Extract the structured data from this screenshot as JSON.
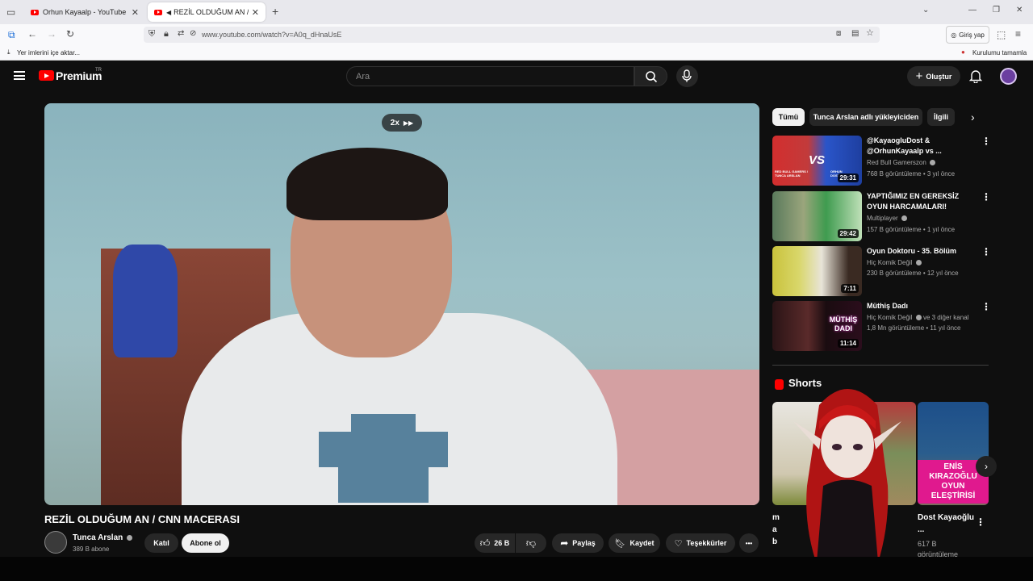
{
  "browser": {
    "tabs": [
      {
        "label": "Orhun Kayaalp - YouTube",
        "active": false
      },
      {
        "label": "REZİL OLDUĞUM AN / CNN",
        "active": true
      }
    ],
    "new_tab": "+",
    "url": "www.youtube.com/watch?v=A0q_dHnaUsE",
    "login_label": "Giriş yap",
    "bookmark_import": "Yer imlerini içe aktar...",
    "setup_notice": "Kurulumu tamamla"
  },
  "header": {
    "logo": "Premium",
    "logo_sup": "TR",
    "search_placeholder": "Ara",
    "create_label": "Oluştur",
    "create_plus": "+"
  },
  "player": {
    "speed": "2x"
  },
  "video": {
    "title": "REZİL OLDUĞUM AN / CNN MACERASI",
    "channel": "Tunca Arslan",
    "subscribers": "389 B abone",
    "join_label": "Katıl",
    "subscribe_label": "Abone ol",
    "likes": "26 B",
    "share_label": "Paylaş",
    "save_label": "Kaydet",
    "thanks_label": "Teşekkürler",
    "more": "•••"
  },
  "chips": [
    "Tümü",
    "Tunca Arslan adlı yükleyiciden",
    "İlgili"
  ],
  "recommendations": [
    {
      "title": "@KayaogluDost & @OrhunKayaalp vs ...",
      "channel": "Red Bull Gamerszon",
      "verified": true,
      "meta": "768 B görüntüleme • 3 yıl önce",
      "duration": "29:31"
    },
    {
      "title": "YAPTIĞIMIZ EN GEREKSİZ OYUN HARCAMALARI!",
      "channel": "Multiplayer",
      "verified": true,
      "meta": "157 B görüntüleme • 1 yıl önce",
      "duration": "29:42"
    },
    {
      "title": "Oyun Doktoru - 35. Bölüm",
      "channel": "Hiç Komik Değil",
      "verified": true,
      "meta": "230 B görüntüleme • 12 yıl önce",
      "duration": "7:11"
    },
    {
      "title": "Müthiş Dadı",
      "channel": "Hiç Komik Değil",
      "verified": true,
      "channel_extra": "ve 3 diğer kanal",
      "meta": "1,8 Mn görüntüleme • 11 yıl önce",
      "duration": "11:14"
    }
  ],
  "shorts": {
    "title": "Shorts",
    "items": [
      {
        "title": "ma b",
        "meta": ""
      },
      {
        "title": "",
        "meta": ""
      },
      {
        "title": "Dost Kayaoğlu ...",
        "meta": "617 B görüntüleme",
        "thumb_caption": "ENİS KIRAZOĞLU OYUN ELEŞTİRİSİ"
      }
    ]
  },
  "thumb_texts": {
    "rec1_left": "RED BULL GAMERS / TUNCA ARSLAN",
    "rec1_vs": "VS",
    "rec1_right": "ORHUN DOST",
    "rec4_text": "MÜTHİŞ DADI"
  },
  "colors": {
    "brand": "#ff0000",
    "background": "#0f0f0f",
    "chip": "#272727",
    "text_secondary": "#aaaaaa"
  }
}
